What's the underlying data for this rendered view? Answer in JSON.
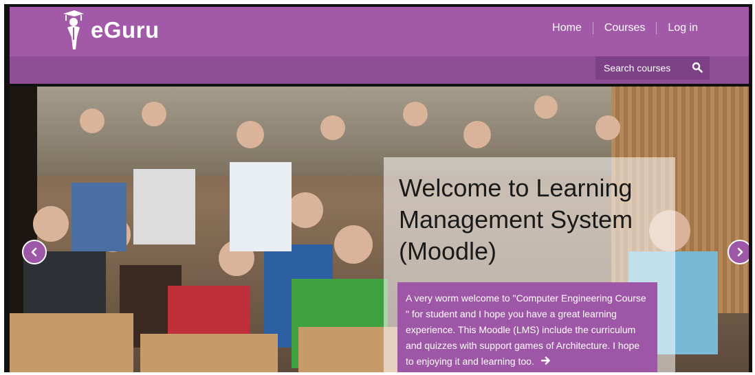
{
  "brand": {
    "name": "eGuru",
    "logo_icon": "graduate-figure-icon"
  },
  "nav": {
    "items": [
      "Home",
      "Courses",
      "Log in"
    ]
  },
  "search": {
    "placeholder": "Search courses",
    "icon": "search-icon"
  },
  "slide": {
    "title": "Welcome to Learning Management System (Moodle)",
    "text": "A very worm welcome to \"Computer Engineering Course \" for student and I hope you have a great learning experience. This Moodle (LMS) include the curriculum and quizzes with support games of Architecture. I hope to enjoying it and learning too.",
    "image_description": "lecture-hall-students"
  },
  "colors": {
    "primary": "#a259a8",
    "secondary": "#8f4d95",
    "accent": "#9e56a6"
  }
}
